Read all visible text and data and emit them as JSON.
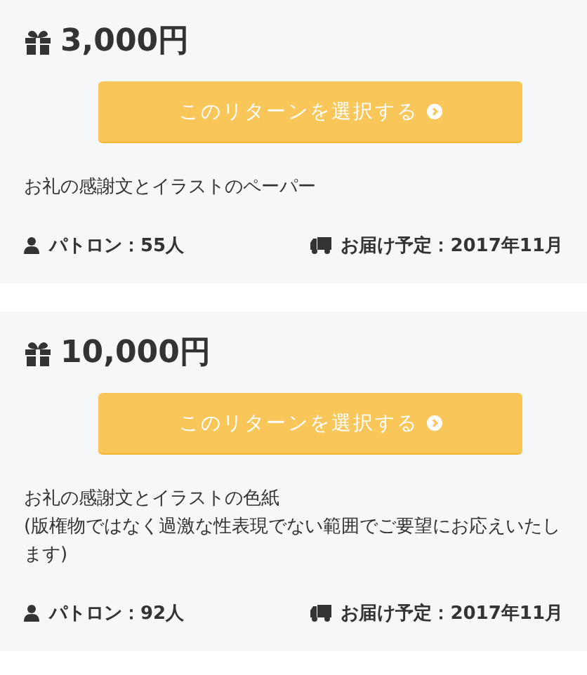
{
  "rewards": [
    {
      "price": "3,000円",
      "button": "このリターンを選択する",
      "description": "お礼の感謝文とイラストのペーパー",
      "patrons": "パトロン：55人",
      "delivery": "お届け予定：2017年11月"
    },
    {
      "price": "10,000円",
      "button": "このリターンを選択する",
      "description": "お礼の感謝文とイラストの色紙\n(版権物ではなく過激な性表現でない範囲でご要望にお応えいたします)",
      "patrons": "パトロン：92人",
      "delivery": "お届け予定：2017年11月"
    }
  ]
}
